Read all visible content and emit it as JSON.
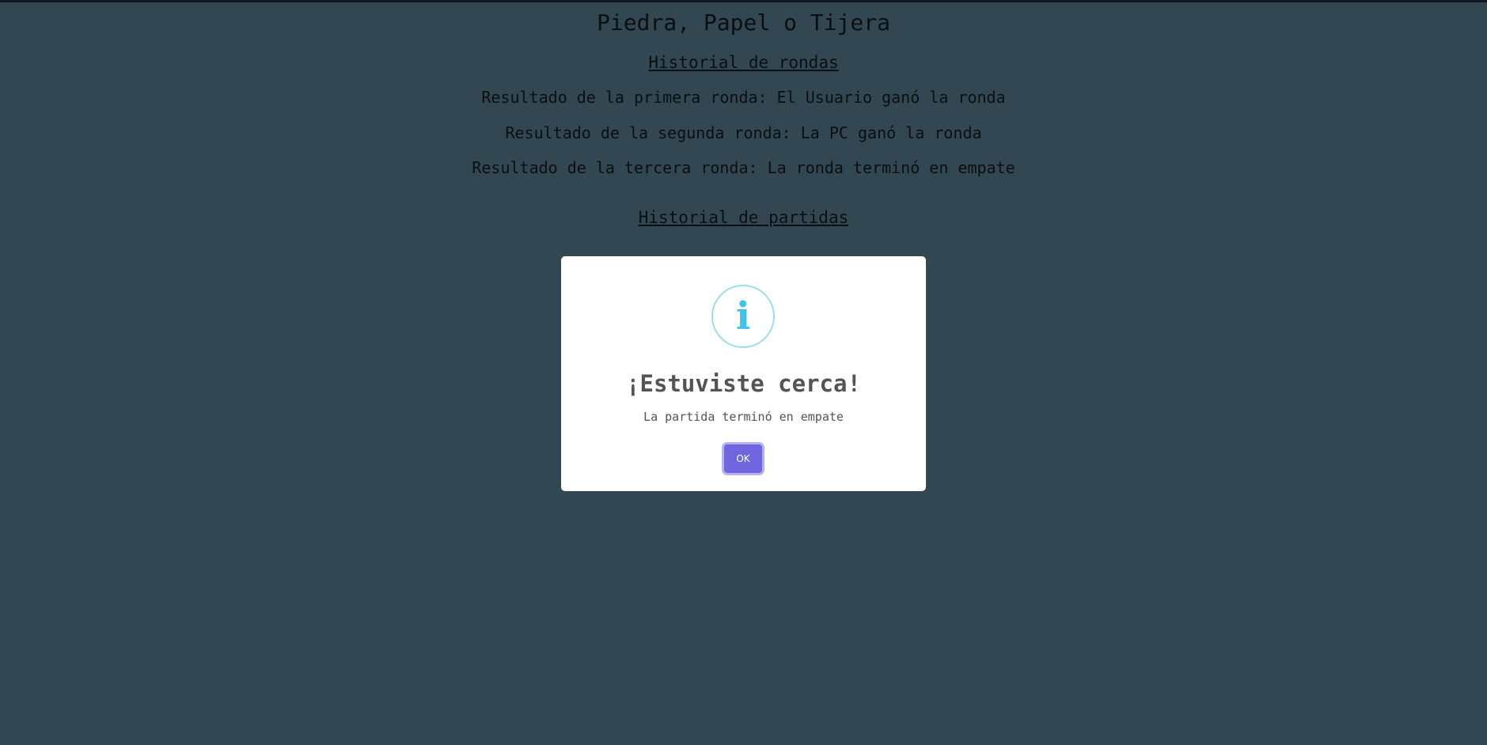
{
  "page": {
    "title": "Piedra, Papel o Tijera",
    "rounds_heading": "Historial de rondas",
    "rounds": [
      "Resultado de la primera ronda: El Usuario ganó la ronda",
      "Resultado de la segunda ronda: La PC ganó la ronda",
      "Resultado de la tercera ronda: La ronda terminó en empate"
    ],
    "matches_heading": "Historial de partidas"
  },
  "modal": {
    "icon_glyph": "i",
    "icon": "info-icon",
    "title": "¡Estuviste cerca!",
    "text": "La partida terminó en empate",
    "ok_label": "OK"
  },
  "colors": {
    "background": "#324752",
    "modal_background": "#ffffff",
    "info_icon": "#3fc3ee",
    "ok_button": "#7066e0"
  }
}
